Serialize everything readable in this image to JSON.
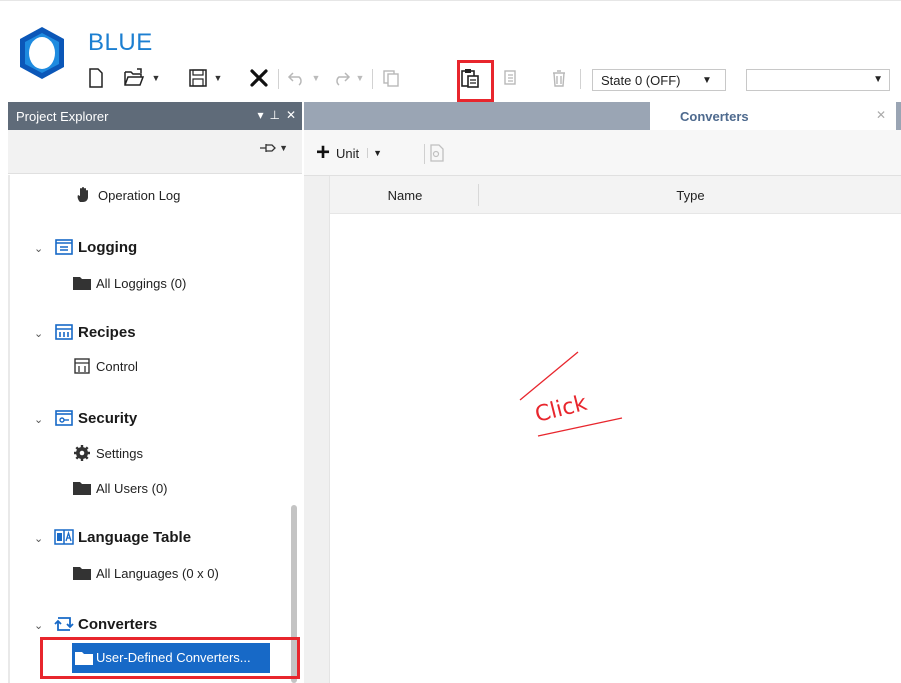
{
  "app": {
    "title": "BLUE"
  },
  "toolbar": {
    "state_value": "State 0 (OFF)",
    "second_combo_value": ""
  },
  "project_explorer": {
    "title": "Project Explorer",
    "tree": {
      "operation_log": "Operation Log",
      "logging": {
        "label": "Logging",
        "child": "All Loggings (0)"
      },
      "recipes": {
        "label": "Recipes",
        "child": "Control"
      },
      "security": {
        "label": "Security",
        "children": [
          "Settings",
          "All Users (0)"
        ]
      },
      "language_table": {
        "label": "Language Table",
        "child": "All Languages (0 x 0)"
      },
      "converters": {
        "label": "Converters",
        "child": "User-Defined Converters..."
      }
    }
  },
  "document": {
    "tab_label": "Converters",
    "add_button_label": "Unit",
    "grid": {
      "columns": [
        "Name",
        "Type"
      ]
    }
  },
  "annotation": {
    "text": "Click",
    "color": "#e8262d"
  },
  "colors": {
    "accent": "#1c7fd1",
    "selection": "#1769c7",
    "panel_title": "#5f6b79",
    "tab_strip": "#9aa5b4",
    "highlight": "#e8262d"
  }
}
